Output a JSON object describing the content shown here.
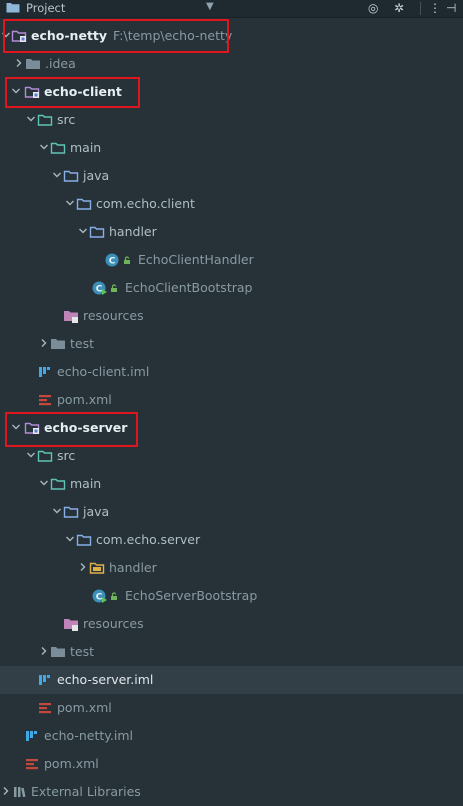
{
  "header": {
    "title": "Project"
  },
  "tree": [
    {
      "label": "echo-netty",
      "path": "F:\\temp\\echo-netty"
    },
    {
      "label": ".idea"
    },
    {
      "label": "echo-client"
    },
    {
      "label": "src"
    },
    {
      "label": "main"
    },
    {
      "label": "java"
    },
    {
      "label": "com.echo.client"
    },
    {
      "label": "handler"
    },
    {
      "label": "EchoClientHandler"
    },
    {
      "label": "EchoClientBootstrap"
    },
    {
      "label": "resources"
    },
    {
      "label": "test"
    },
    {
      "label": "echo-client.iml"
    },
    {
      "label": "pom.xml"
    },
    {
      "label": "echo-server"
    },
    {
      "label": "src"
    },
    {
      "label": "main"
    },
    {
      "label": "java"
    },
    {
      "label": "com.echo.server"
    },
    {
      "label": "handler"
    },
    {
      "label": "EchoServerBootstrap"
    },
    {
      "label": "resources"
    },
    {
      "label": "test"
    },
    {
      "label": "echo-server.iml"
    },
    {
      "label": "pom.xml"
    },
    {
      "label": "echo-netty.iml"
    },
    {
      "label": "pom.xml"
    },
    {
      "label": "External Libraries"
    }
  ],
  "colors": {
    "background": "#263238",
    "selected_row": "#333f47",
    "highlight_box": "#e0161f",
    "folder": "#8fb8d8",
    "source_folder": "#5bbfb4",
    "module": "#b58ad9"
  }
}
